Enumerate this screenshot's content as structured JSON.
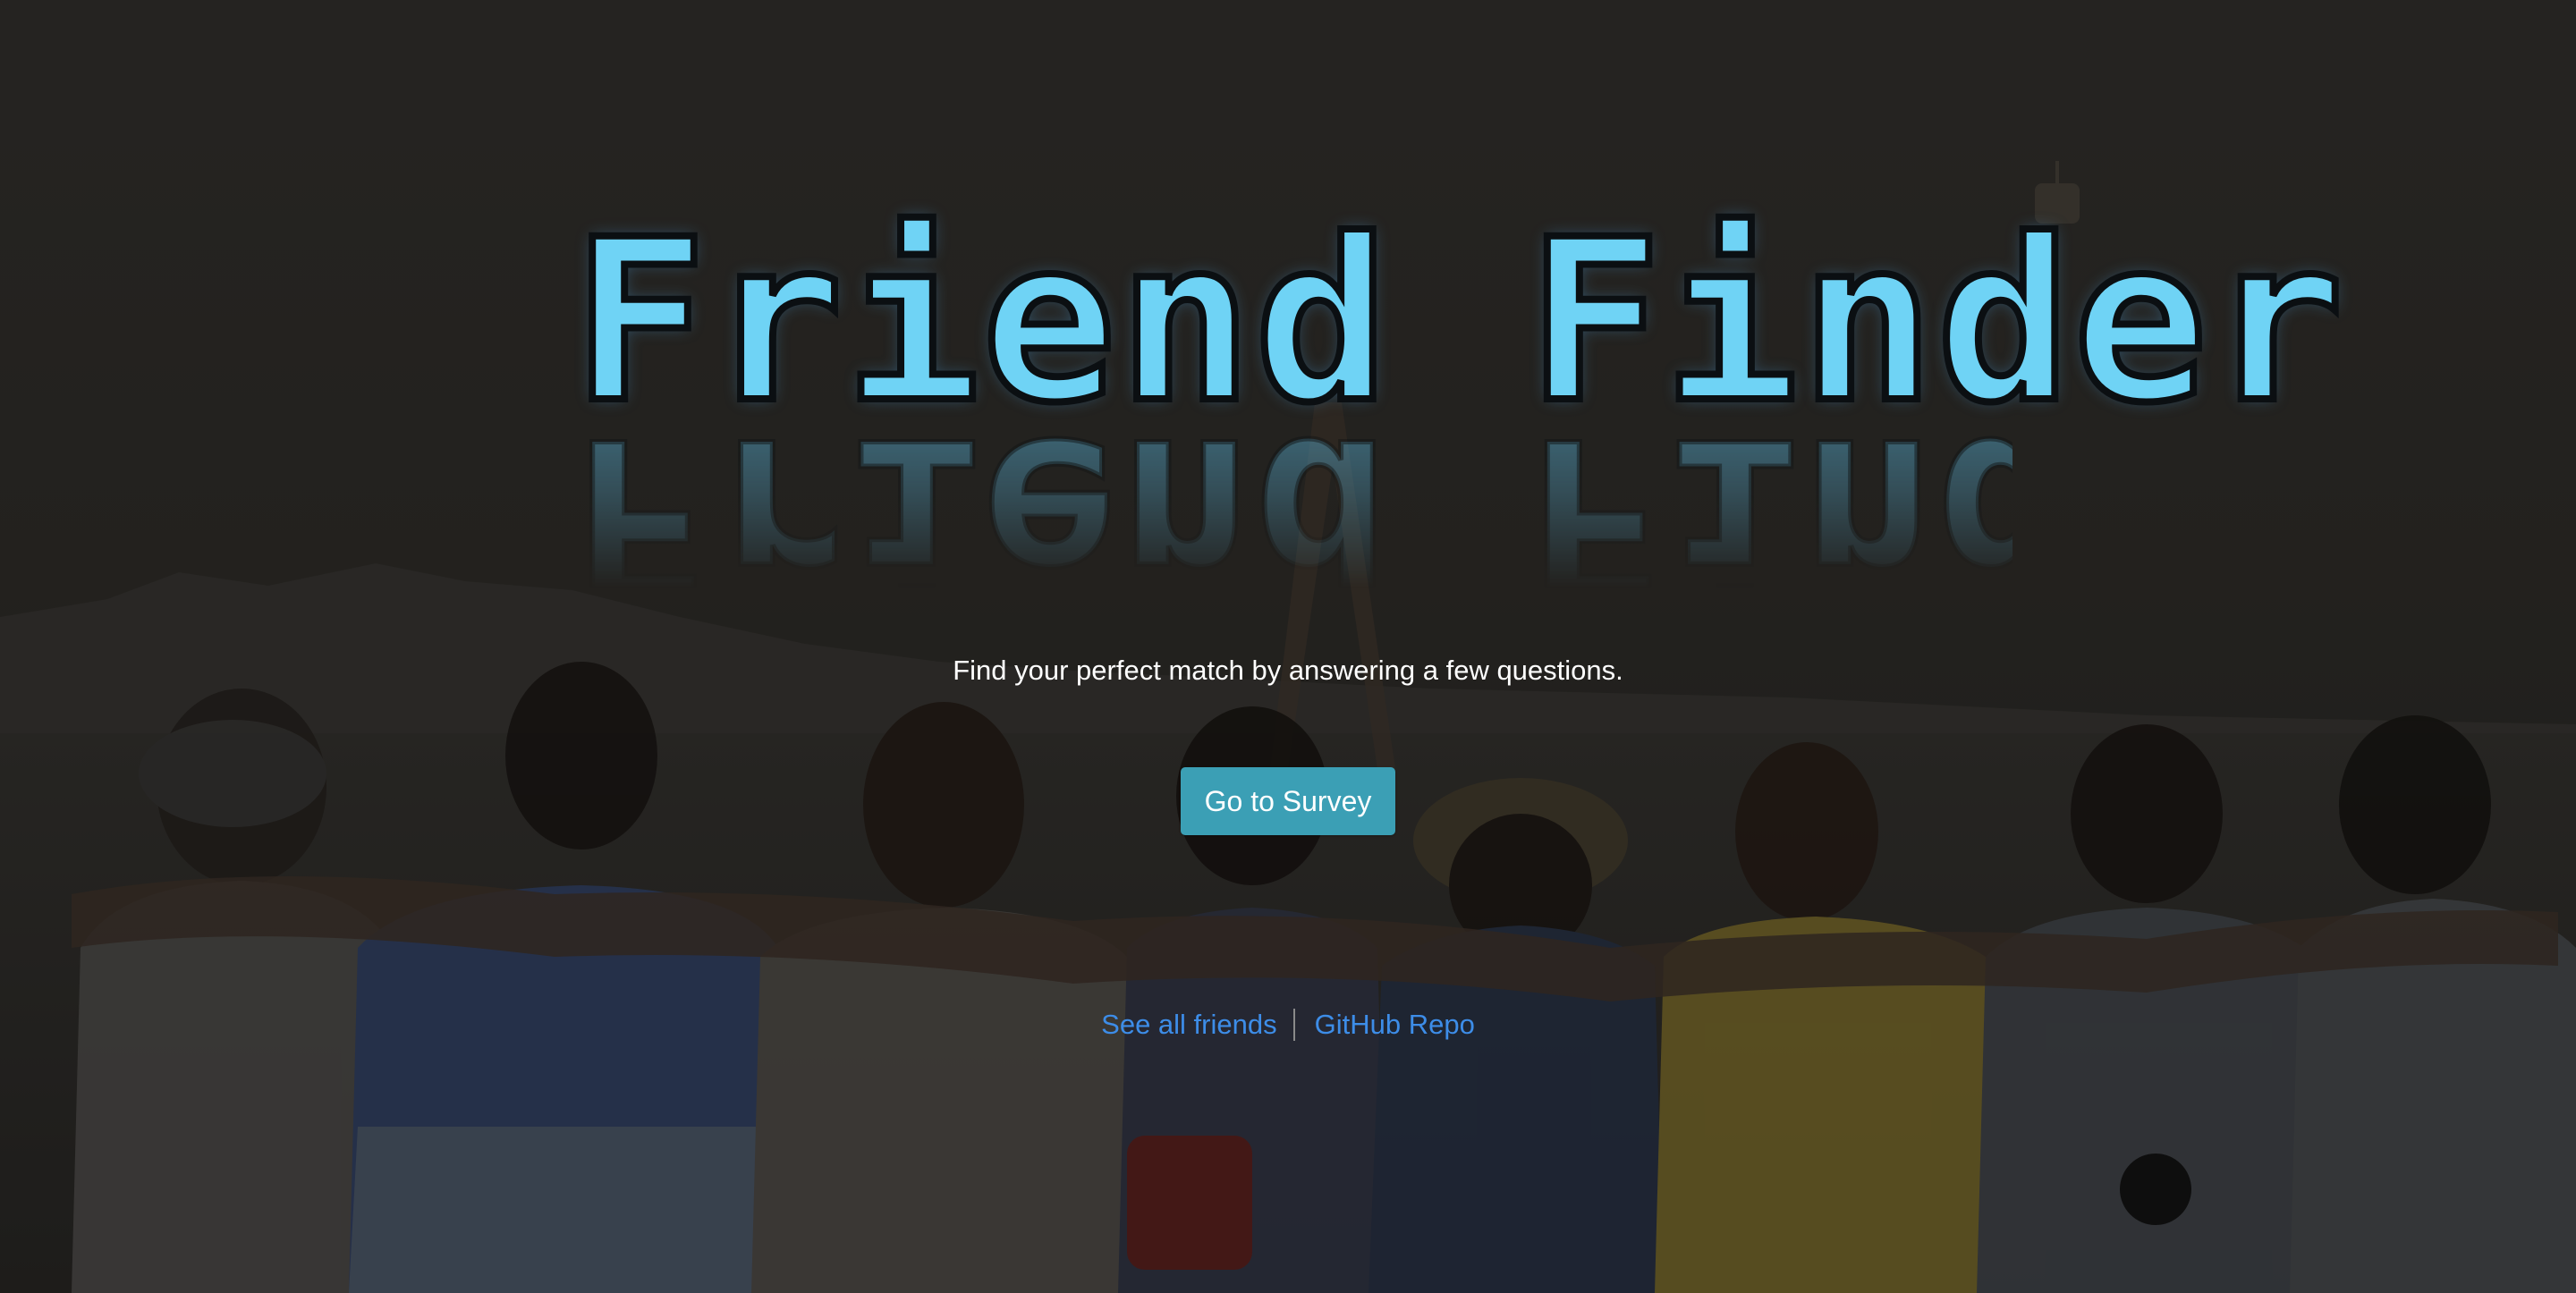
{
  "hero": {
    "title": "Friend Finder",
    "tagline": "Find your perfect match by answering a few questions.",
    "survey_button": "Go to Survey"
  },
  "links": {
    "friends": "See all friends",
    "repo": "GitHub Repo"
  },
  "colors": {
    "title": "#6fd3f5",
    "button": "#3b9fb5",
    "link": "#3d8de8",
    "text": "#ffffff"
  }
}
